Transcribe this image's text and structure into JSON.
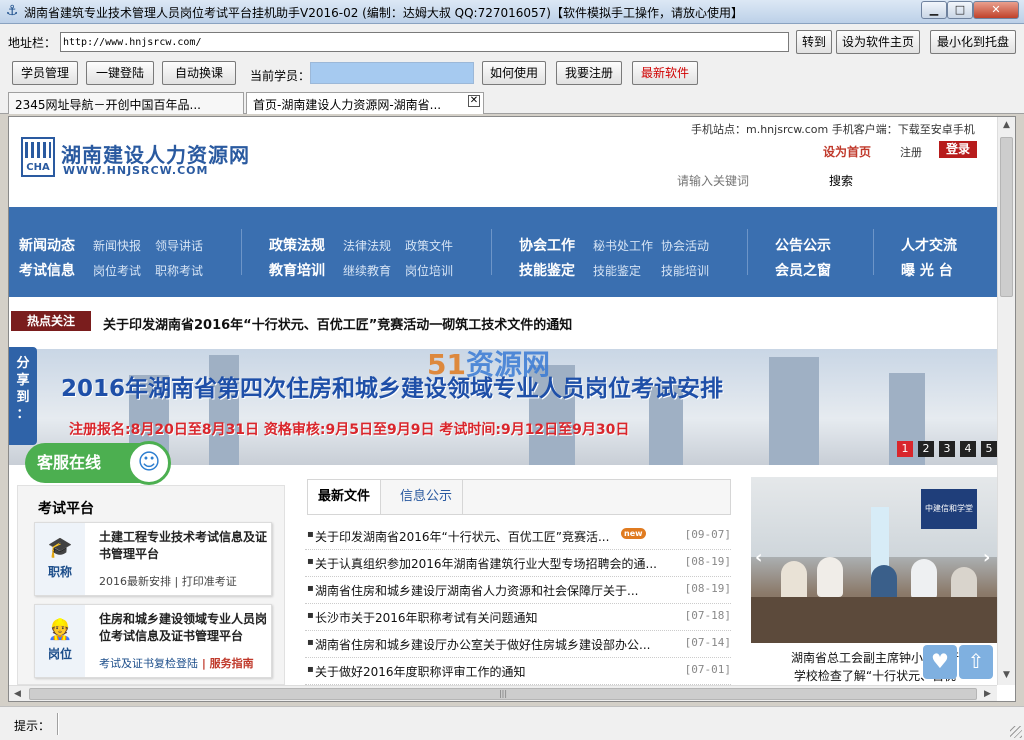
{
  "window": {
    "title": "湖南省建筑专业技术管理人员岗位考试平台挂机助手V2016-02 (编制：达姆大叔 QQ:727016057)【软件模拟手工操作，请放心使用】",
    "min_glyph": "▁",
    "max_glyph": "□",
    "close_glyph": "✕",
    "icon_glyph": "⚓"
  },
  "address": {
    "label": "地址栏：",
    "url": "http://www.hnjsrcw.com/",
    "goto_label": "转到",
    "set_home_label": "设为软件主页",
    "minimize_tray_label": "最小化到托盘"
  },
  "toolbar": {
    "student_mgmt": "学员管理",
    "one_click_login": "一键登陆",
    "auto_switch": "自动换课",
    "current_student_label": "当前学员：",
    "current_student_value": "",
    "how_to_use": "如何使用",
    "register": "我要注册",
    "latest_software": "最新软件"
  },
  "tabs": [
    {
      "label": "2345网址导航－开创中国百年品..."
    },
    {
      "label": "首页-湖南建设人力资源网-湖南省..."
    }
  ],
  "site": {
    "logo_cha": "CHA",
    "logo_cn": "湖南建设人力资源网",
    "logo_en": "WWW.HNJSRCW.COM",
    "mobile_info": "手机站点：m.hnjsrcw.com  手机客户端：下载至安卓手机",
    "set_home": "设为首页",
    "register": "注册",
    "login": "登录",
    "search_placeholder": "请输入关键词",
    "search_button": "搜索",
    "nav": [
      {
        "head": "新闻动态",
        "subs": [
          "新闻快报",
          "领导讲话"
        ]
      },
      {
        "head": "考试信息",
        "subs": [
          "岗位考试",
          "职称考试"
        ]
      },
      {
        "head": "政策法规",
        "subs": [
          "法律法规",
          "政策文件"
        ]
      },
      {
        "head": "教育培训",
        "subs": [
          "继续教育",
          "岗位培训"
        ]
      },
      {
        "head": "协会工作",
        "subs": [
          "秘书处工作",
          "协会活动"
        ]
      },
      {
        "head": "技能鉴定",
        "subs": [
          "技能鉴定",
          "技能培训"
        ]
      },
      {
        "head": "公告公示",
        "subs": []
      },
      {
        "head": "会员之窗",
        "subs": []
      },
      {
        "head": "人才交流",
        "subs": []
      },
      {
        "head": "曝 光 台",
        "subs": []
      }
    ],
    "hot_tag": "热点关注",
    "hot_text": "关于印发湖南省2016年“十行状元、百优工匠”竞赛活动一砌筑工技术文件的通知",
    "banner_logo_a": "51",
    "banner_logo_b": "资源网",
    "banner_title": "2016年湖南省第四次住房和城乡建设领域专业人员岗位考试安排",
    "banner_sub": "注册报名:8月20日至8月31日  资格审核:9月5日至9月9日  考试时间:9月12日至9月30日",
    "pager": [
      "1",
      "2",
      "3",
      "4",
      "5"
    ],
    "share": [
      "分",
      "享",
      "到",
      "："
    ],
    "cs_online": "客服在线",
    "cs_icon": "☺",
    "exam_title": "考试平台",
    "exam_cards": [
      {
        "icon_glyph": "🎓",
        "icon_label": "职称",
        "title": "土建工程专业技术考试信息及证书管理平台",
        "sub_a": "2016最新安排",
        "sub_b": " | 打印准考证"
      },
      {
        "icon_glyph": "👷",
        "icon_label": "岗位",
        "title": "住房和城乡建设领域专业人员岗位考试信息及证书管理平台",
        "sub_a": "考试及证书复检登陆",
        "sub_b": " | 服务指南"
      }
    ],
    "news_tabs": [
      "最新文件",
      "信息公示"
    ],
    "news": [
      {
        "title": "关于印发湖南省2016年“十行状元、百优工匠”竞赛活...",
        "date": "[09-07]",
        "new": true
      },
      {
        "title": "关于认真组织参加2016年湖南省建筑行业大型专场招聘会的通...",
        "date": "[08-19]",
        "new": false
      },
      {
        "title": "湖南省住房和城乡建设厅湖南省人力资源和社会保障厅关于...",
        "date": "[08-19]",
        "new": false
      },
      {
        "title": "长沙市关于2016年职称考试有关问题通知",
        "date": "[07-18]",
        "new": false
      },
      {
        "title": "湖南省住房和城乡建设厅办公室关于做好住房城乡建设部办公...",
        "date": "[07-14]",
        "new": false
      },
      {
        "title": "关于做好2016年度职称评审工作的通知",
        "date": "[07-01]",
        "new": false
      }
    ],
    "new_badge": "new",
    "photo_board": "中建信和学堂",
    "photo_caption_1": "湖南省总工会副主席钟小汨一行",
    "photo_caption_2": "学校检查了解“十行状元、百优",
    "float_fav": "♥",
    "float_top": "⇧"
  },
  "status": {
    "label": "提示：",
    "text": ""
  }
}
